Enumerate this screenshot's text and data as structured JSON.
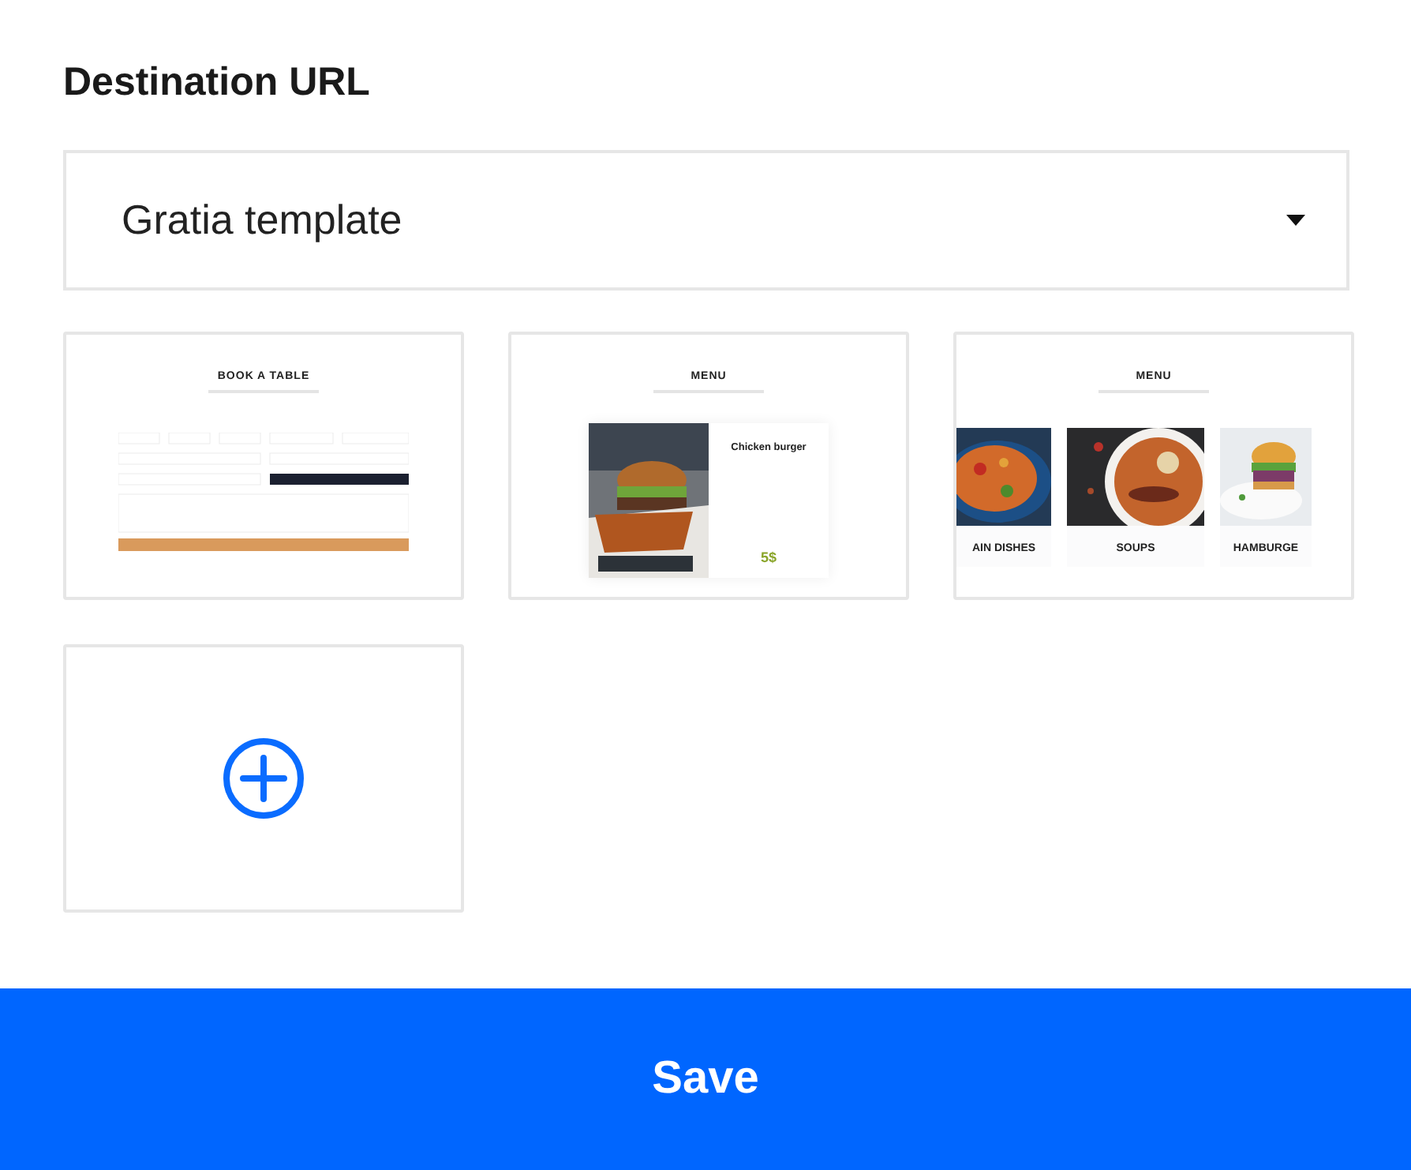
{
  "title": "Destination URL",
  "dropdown": {
    "value": "Gratia template"
  },
  "templates": [
    {
      "kind": "booking",
      "heading": "BOOK A TABLE"
    },
    {
      "kind": "menu-card",
      "heading": "MENU",
      "dish": "Chicken burger",
      "price": "5$"
    },
    {
      "kind": "menu-grid",
      "heading": "MENU",
      "categories": [
        "AIN DISHES",
        "SOUPS",
        "HAMBURGE"
      ]
    }
  ],
  "save_button": "Save"
}
